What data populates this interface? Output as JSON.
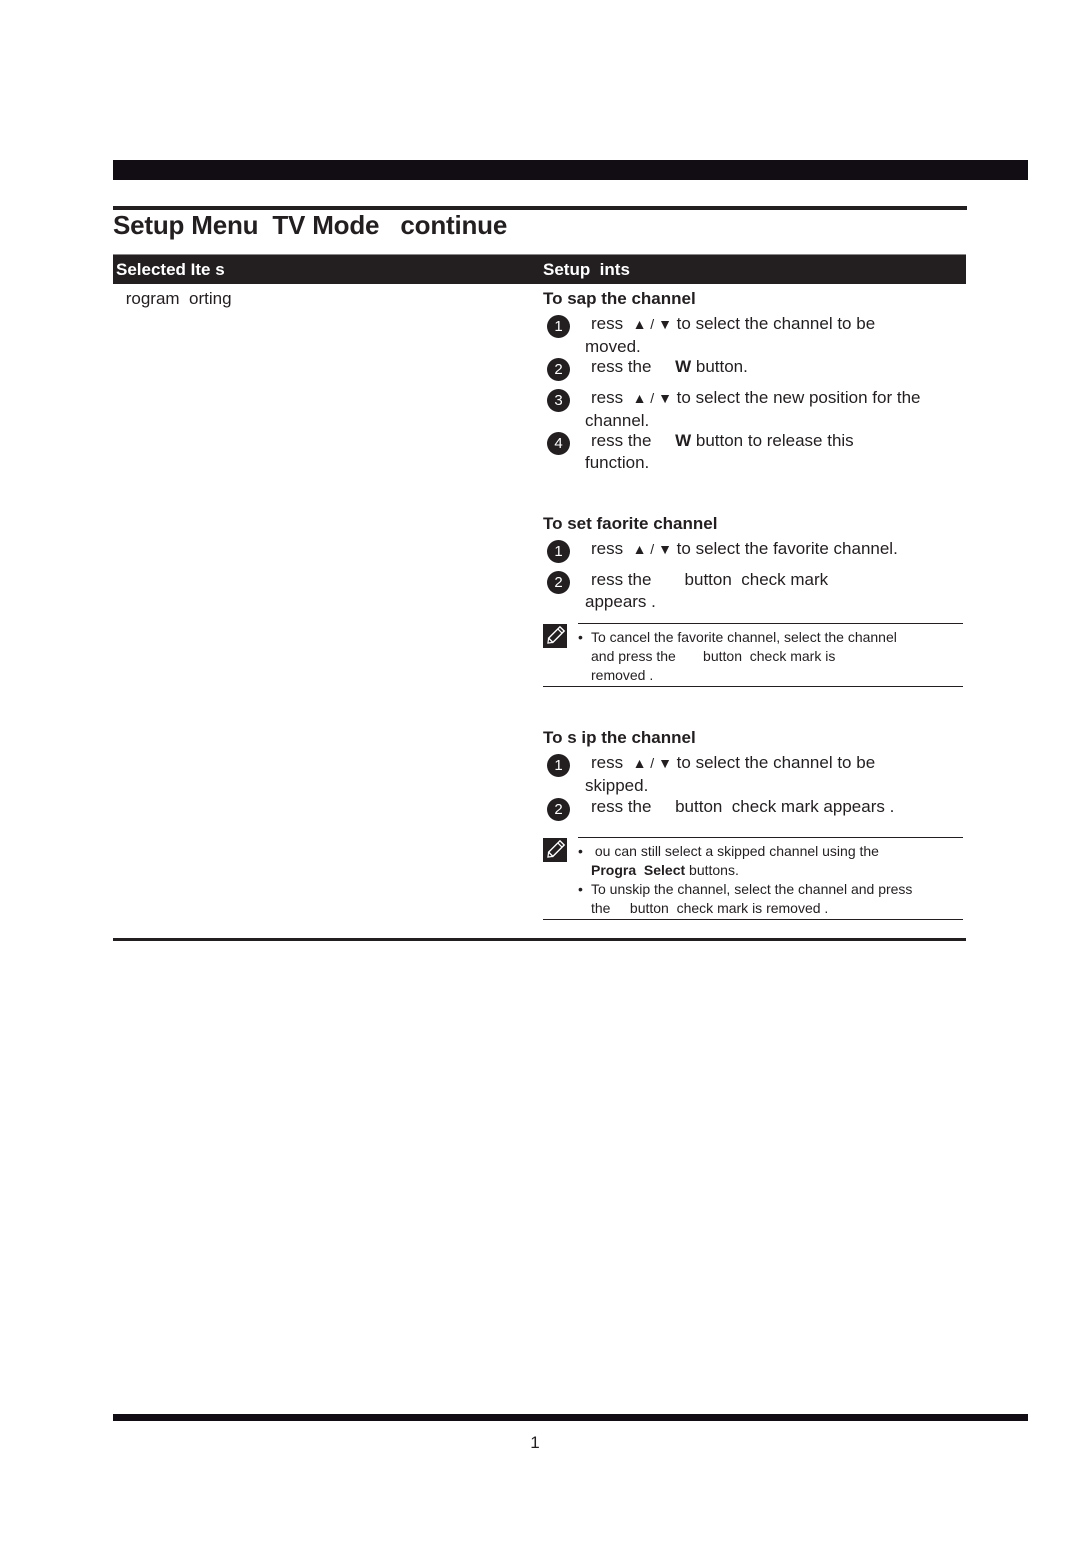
{
  "page": {
    "title": "Setup Menu  TV Mode   continue",
    "page_number": "1"
  },
  "table": {
    "header_left": "Selected Ite s",
    "header_right": "Setup  ints",
    "item_label": " rogram  orting"
  },
  "sections": {
    "swap": {
      "title": "To sap the channel",
      "steps": [
        {
          "num": "1",
          "pre": "ress  ",
          "arrows": "▲ / ▼",
          "post": " to select the channel to be",
          "cont": "moved."
        },
        {
          "num": "2",
          "pre": "ress the     ",
          "bold": "W",
          "post": " button.",
          "cont": ""
        },
        {
          "num": "3",
          "pre": "ress  ",
          "arrows": "▲ / ▼",
          "post": " to select the new position for the",
          "cont": "channel."
        },
        {
          "num": "4",
          "pre": "ress the     ",
          "bold": "W",
          "post": " button to release this",
          "cont": "function."
        }
      ]
    },
    "favorite": {
      "title": "To set faorite channel",
      "steps": [
        {
          "num": "1",
          "pre": "ress  ",
          "arrows": "▲ / ▼",
          "post": " to select the favorite channel.",
          "cont": ""
        },
        {
          "num": "2",
          "pre": "ress the       button  check mark",
          "cont": "appears ."
        }
      ],
      "note": {
        "icon": "pencil-note-icon",
        "bullets": [
          "To cancel the favorite channel, select the channel\nand press the       button  check mark is\nremoved ."
        ]
      }
    },
    "skip": {
      "title": "To s ip the channel",
      "steps": [
        {
          "num": "1",
          "pre": "ress  ",
          "arrows": "▲ / ▼",
          "post": " to select the channel to be",
          "cont": "skipped."
        },
        {
          "num": "2",
          "pre": "ress the     button  check mark appears .",
          "cont": ""
        }
      ],
      "note": {
        "icon": "pencil-note-icon",
        "bullet1_a": " ou can still select a skipped channel using the",
        "bullet1_bold": "Progra  Select",
        "bullet1_b": " buttons.",
        "bullet2": "To unskip the channel, select the channel and press\nthe     button  check mark is removed ."
      }
    }
  }
}
